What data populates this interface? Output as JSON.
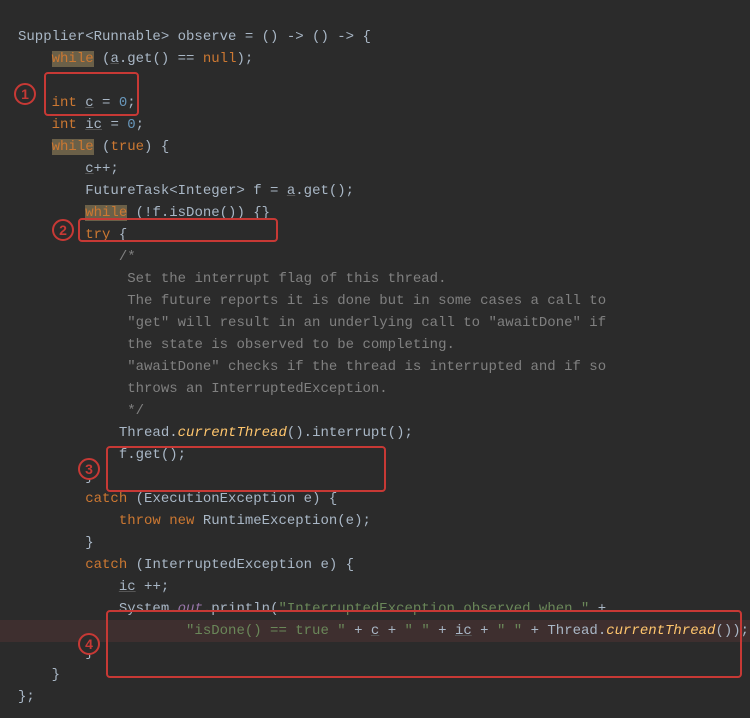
{
  "code": {
    "l01a": "Supplier<Runnable> observe = () -> () -> {",
    "l02_while": "while",
    "l02b": " (",
    "l02c": "a",
    "l02d": ".get() == ",
    "l02e": "null",
    "l02f": ");",
    "l04a": "int",
    "l04b": " ",
    "l04c": "c",
    "l04d": " = ",
    "l04e": "0",
    "l04f": ";",
    "l05a": "int",
    "l05b": " ",
    "l05c": "ic",
    "l05d": " = ",
    "l05e": "0",
    "l05f": ";",
    "l06_while": "while",
    "l06b": " (",
    "l06c": "true",
    "l06d": ") {",
    "l07a": "c",
    "l07b": "++;",
    "l08a": "FutureTask<Integer> f = ",
    "l08b": "a",
    "l08c": ".get();",
    "l09_while": "while",
    "l09b": " (!f.isDone()) {}",
    "l10a": "try",
    "l10b": " {",
    "l11": "/*",
    "l12": " Set the interrupt flag of this thread.",
    "l13": " The future reports it is done but in some cases a call to",
    "l14": " \"get\" will result in an underlying call to \"awaitDone\" if",
    "l15": " the state is observed to be completing.",
    "l16": " \"awaitDone\" checks if the thread is interrupted and if so",
    "l17": " throws an InterruptedException.",
    "l18": " */",
    "l19a": "Thread.",
    "l19b": "currentThread",
    "l19c": "().interrupt();",
    "l20a": "f.get();",
    "l21": "}",
    "l22a": "catch",
    "l22b": " (ExecutionException e) {",
    "l23a": "throw new ",
    "l23b": "RuntimeException(e);",
    "l24": "}",
    "l25a": "catch",
    "l25b": " (InterruptedException e) {",
    "l26a": "ic",
    "l26b": " ++;",
    "l27a": "System.",
    "l27b": "out",
    "l27c": ".println(",
    "l27d": "\"InterruptedException observed when \"",
    "l27e": " +",
    "l28a": "\"isDone() == true \"",
    "l28b": " + ",
    "l28c": "c",
    "l28d": " + ",
    "l28e": "\" \"",
    "l28f": " + ",
    "l28g": "ic",
    "l28h": " + ",
    "l28i": "\" \"",
    "l28j": " + Thread.",
    "l28k": "currentThread",
    "l28l": "());",
    "l29": "}",
    "l30": "}",
    "l31": "};"
  },
  "annotations": {
    "c1": "1",
    "c2": "2",
    "c3": "3",
    "c4": "4"
  }
}
